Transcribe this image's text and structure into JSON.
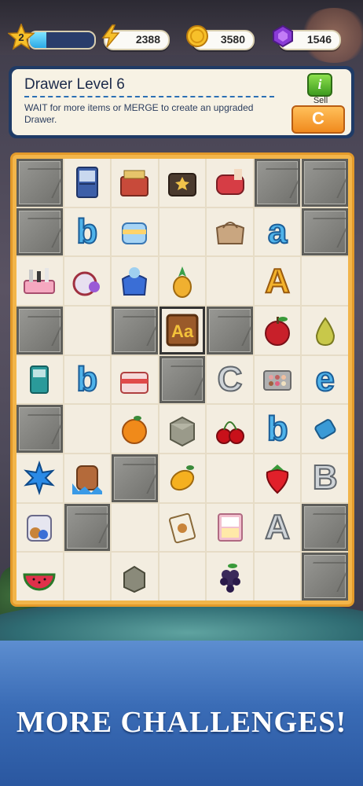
{
  "hud": {
    "level": "2",
    "xp_progress": 0.25,
    "energy": "2388",
    "coins": "3580",
    "gems": "1546"
  },
  "panel": {
    "title": "Drawer Level 6",
    "message": "WAIT for more items or MERGE to create an upgraded Drawer.",
    "info_label": "i",
    "sell_label": "Sell",
    "sell_button": "C"
  },
  "board": {
    "rows": [
      [
        "stone",
        "fridge",
        "sewing-box",
        "chest",
        "makeup-bag",
        "stone",
        "stone"
      ],
      [
        "stone",
        "b",
        "lunchbox",
        "empty",
        "handbag",
        "a",
        "stone"
      ],
      [
        "cosmetics-tray",
        "yarn",
        "gift-bag",
        "pineapple",
        "empty",
        "A",
        "empty"
      ],
      [
        "stone",
        "empty",
        "stone",
        "Aa-box",
        "stone",
        "apple",
        "pear"
      ],
      [
        "fridge-small",
        "b",
        "cake-box",
        "stone",
        "C",
        "makeup-palette",
        "e"
      ],
      [
        "stone",
        "empty",
        "orange",
        "cardboard",
        "cherries",
        "b",
        "candy"
      ],
      [
        "ice-crystal",
        "ice-barrel",
        "stone",
        "mango",
        "empty",
        "strawberry",
        "B"
      ],
      [
        "cookie-bag",
        "stone",
        "empty",
        "cookie-box",
        "pink-fridge",
        "A-silver",
        "stone"
      ],
      [
        "watermelon",
        "empty",
        "cardboard-small",
        "empty",
        "grapes",
        "empty",
        "stone"
      ]
    ]
  },
  "banner": {
    "text": "MORE CHALLENGES!"
  },
  "colors": {
    "board_frame": "#f2b54a",
    "panel_border": "#1f3b66",
    "banner_blue": "#3a6cb6"
  }
}
